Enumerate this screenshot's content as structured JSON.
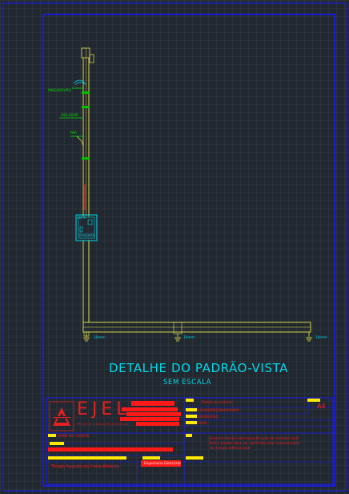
{
  "drawing": {
    "title": "DETALHE DO PADRÃO-VISTA",
    "subtitle": "SEM ESCALA"
  },
  "diagram_labels": {
    "pingadouro": "PINGADOURO",
    "isolador": "ISOLADOR",
    "ponto_mid": "PAR",
    "meter_box": "CM-3",
    "poste": "POSDATA",
    "ground_1": "10mm²",
    "ground_2": "10mm²",
    "ground_3": "10mm²"
  },
  "title_block": {
    "company": "EJEL",
    "company_tagline": "PROJETOS E SOLUÇÕES ELÉTRICAS",
    "sheet_size": "A4",
    "client_label": "NOME DO CLIENTE",
    "author": "Thiago Augusto da Costa Almeida",
    "author_title": "Engenheiro Eletricista",
    "field_1": "Padrão de entrada",
    "field_2": "0000000000000000000",
    "field_3": "00/00/0000",
    "field_4": "0000",
    "note_1": "- Desenho técnico sem especificação de medidas reais",
    "note_2": "- Todo o projeto deve ser verificado pela concessionária",
    "note_3": "de energia elétrica local"
  },
  "colors": {
    "background": "#212830",
    "frame": "#1a1aff",
    "conductor": "#e8e84a",
    "annotation": "#00d8e8",
    "label_green": "#00e000",
    "highlight": "#ffea00",
    "brand_red": "#e52020"
  }
}
